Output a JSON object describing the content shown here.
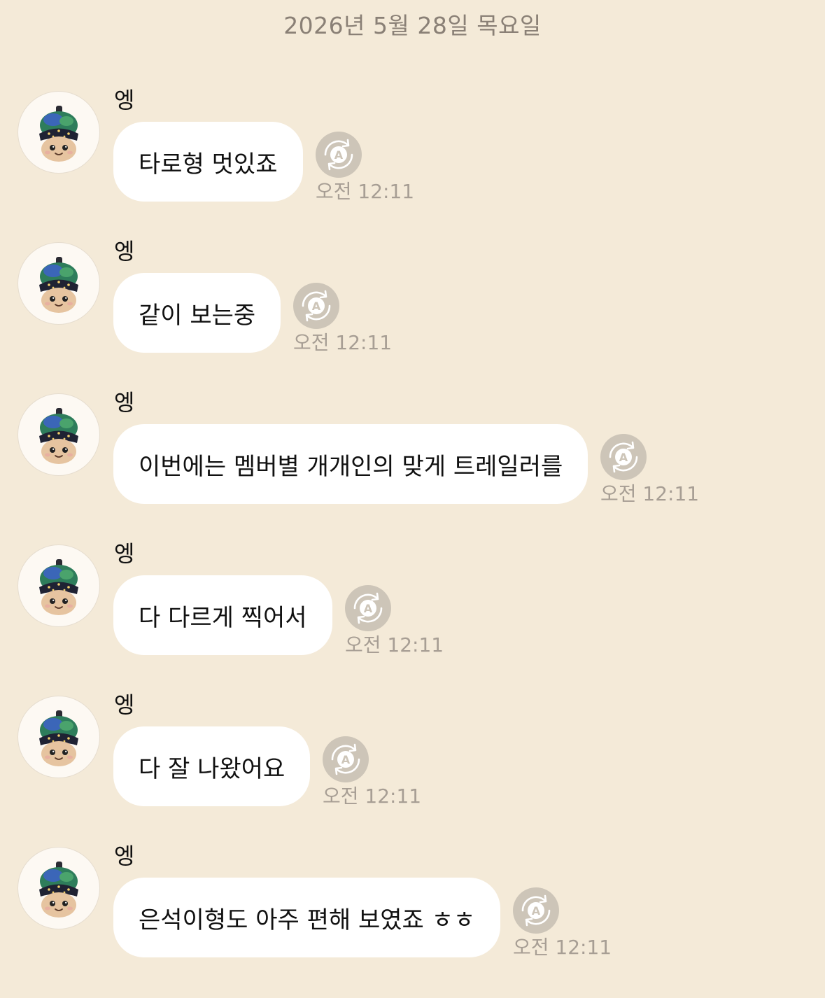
{
  "date_header": "2026년 5월 28일 목요일",
  "colors": {
    "background": "#f4ead8",
    "bubble": "#ffffff",
    "translate_button": "#cdc5b8",
    "meta_text": "#a79e94"
  },
  "messages": [
    {
      "sender": "엥",
      "text": "타로형 멋있죠",
      "time": "오전 12:11",
      "avatar_icon": "plush-doll-avatar-icon",
      "action_icon": "translate-icon"
    },
    {
      "sender": "엥",
      "text": "같이 보는중",
      "time": "오전 12:11",
      "avatar_icon": "plush-doll-avatar-icon",
      "action_icon": "translate-icon"
    },
    {
      "sender": "엥",
      "text": "이번에는 멤버별 개개인의 맞게 트레일러를",
      "time": "오전 12:11",
      "avatar_icon": "plush-doll-avatar-icon",
      "action_icon": "translate-icon"
    },
    {
      "sender": "엥",
      "text": "다 다르게 찍어서",
      "time": "오전 12:11",
      "avatar_icon": "plush-doll-avatar-icon",
      "action_icon": "translate-icon"
    },
    {
      "sender": "엥",
      "text": "다 잘 나왔어요",
      "time": "오전 12:11",
      "avatar_icon": "plush-doll-avatar-icon",
      "action_icon": "translate-icon"
    },
    {
      "sender": "엥",
      "text": "은석이형도 아주 편해 보였죠 ㅎㅎ",
      "time": "오전 12:11",
      "avatar_icon": "plush-doll-avatar-icon",
      "action_icon": "translate-icon"
    }
  ]
}
